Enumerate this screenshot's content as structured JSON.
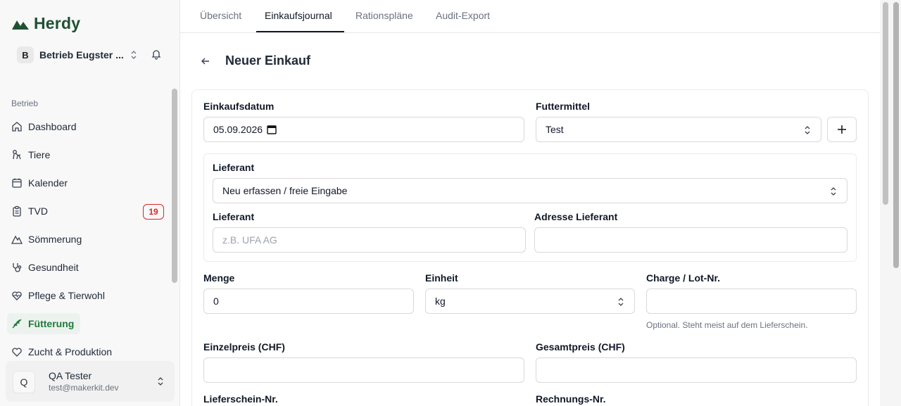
{
  "app": {
    "name": "Herdy"
  },
  "org": {
    "avatar": "B",
    "name": "Betrieb Eugster ..."
  },
  "sidebar": {
    "section": "Betrieb",
    "items": [
      {
        "label": "Dashboard",
        "icon": "home-icon"
      },
      {
        "label": "Tiere",
        "icon": "animal-icon"
      },
      {
        "label": "Kalender",
        "icon": "calendar-icon"
      },
      {
        "label": "TVD",
        "icon": "clipboard-icon",
        "badge": "19"
      },
      {
        "label": "Sömmerung",
        "icon": "mountain-icon"
      },
      {
        "label": "Gesundheit",
        "icon": "stethoscope-icon"
      },
      {
        "label": "Pflege & Tierwohl",
        "icon": "heart-pulse-icon"
      },
      {
        "label": "Fütterung",
        "icon": "wheat-icon",
        "active": true
      },
      {
        "label": "Zucht & Produktion",
        "icon": "heart-icon"
      }
    ]
  },
  "user": {
    "avatar": "Q",
    "name": "QA Tester",
    "email": "test@makerkit.dev"
  },
  "tabs": [
    {
      "label": "Übersicht"
    },
    {
      "label": "Einkaufsjournal",
      "active": true
    },
    {
      "label": "Rationspläne"
    },
    {
      "label": "Audit-Export"
    }
  ],
  "page": {
    "title": "Neuer Einkauf"
  },
  "form": {
    "einkaufsdatum": {
      "label": "Einkaufsdatum",
      "value": "05.09.2026"
    },
    "futtermittel": {
      "label": "Futtermittel",
      "value": "Test"
    },
    "lieferant_select": {
      "label": "Lieferant",
      "value": "Neu erfassen / freie Eingabe"
    },
    "lieferant_input": {
      "label": "Lieferant",
      "placeholder": "z.B. UFA AG",
      "value": ""
    },
    "adresse": {
      "label": "Adresse Lieferant",
      "value": ""
    },
    "menge": {
      "label": "Menge",
      "value": "0"
    },
    "einheit": {
      "label": "Einheit",
      "value": "kg"
    },
    "charge": {
      "label": "Charge / Lot-Nr.",
      "value": "",
      "hint": "Optional. Steht meist auf dem Lieferschein."
    },
    "einzelpreis": {
      "label": "Einzelpreis (CHF)",
      "value": ""
    },
    "gesamtpreis": {
      "label": "Gesamtpreis (CHF)",
      "value": ""
    },
    "lieferschein": {
      "label": "Lieferschein-Nr."
    },
    "rechnung": {
      "label": "Rechnungs-Nr."
    }
  },
  "colors": {
    "brand": "#1f5132",
    "active": "#1f7a3a",
    "badge": "#dc2626"
  }
}
